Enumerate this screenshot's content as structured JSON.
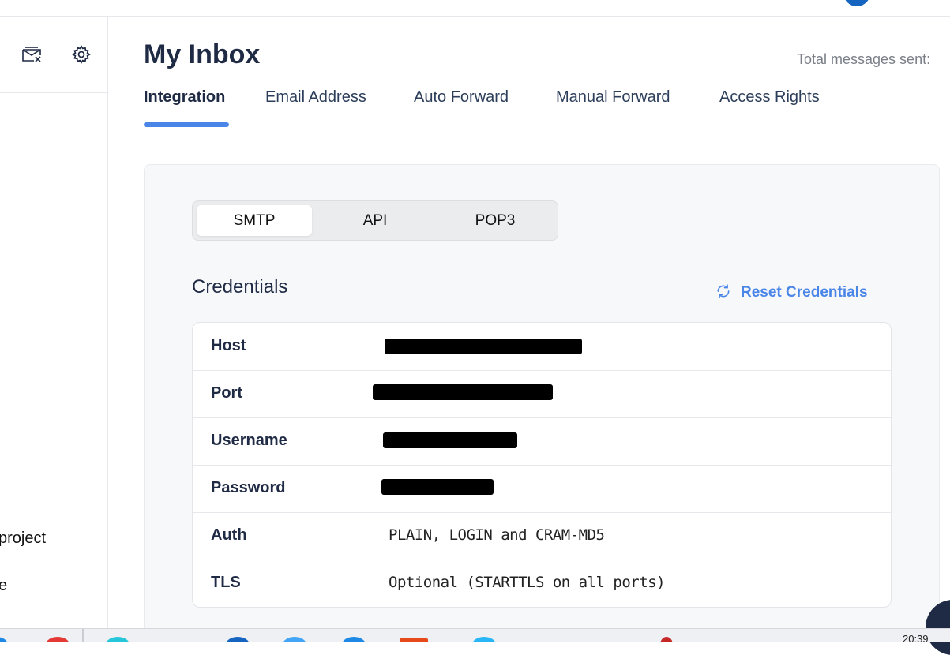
{
  "header": {
    "title": "My Inbox",
    "total_messages_label": "Total messages sent:"
  },
  "sidebar": {
    "partial_items": [
      "project",
      "e"
    ]
  },
  "tabs": [
    {
      "label": "Integration",
      "active": true
    },
    {
      "label": "Email Address",
      "active": false
    },
    {
      "label": "Auto Forward",
      "active": false
    },
    {
      "label": "Manual Forward",
      "active": false
    },
    {
      "label": "Access Rights",
      "active": false
    }
  ],
  "protocol_switch": {
    "options": [
      "SMTP",
      "API",
      "POP3"
    ],
    "selected": "SMTP"
  },
  "credentials": {
    "title": "Credentials",
    "reset_label": "Reset Credentials",
    "rows": [
      {
        "label": "Host",
        "value": "",
        "redacted": true
      },
      {
        "label": "Port",
        "value": "",
        "redacted": true
      },
      {
        "label": "Username",
        "value": "",
        "redacted": true
      },
      {
        "label": "Password",
        "value": "",
        "redacted": true
      },
      {
        "label": "Auth",
        "value": "PLAIN, LOGIN and CRAM-MD5",
        "redacted": false
      },
      {
        "label": "TLS",
        "value": "Optional (STARTTLS on all ports)",
        "redacted": false
      }
    ]
  },
  "taskbar": {
    "clock": "20:39"
  },
  "colors": {
    "accent": "#4a86e8",
    "heading": "#1f2a44",
    "panel_bg": "#f7f8f9"
  },
  "icons": [
    "mail-x-icon",
    "gear-icon",
    "refresh-icon"
  ]
}
